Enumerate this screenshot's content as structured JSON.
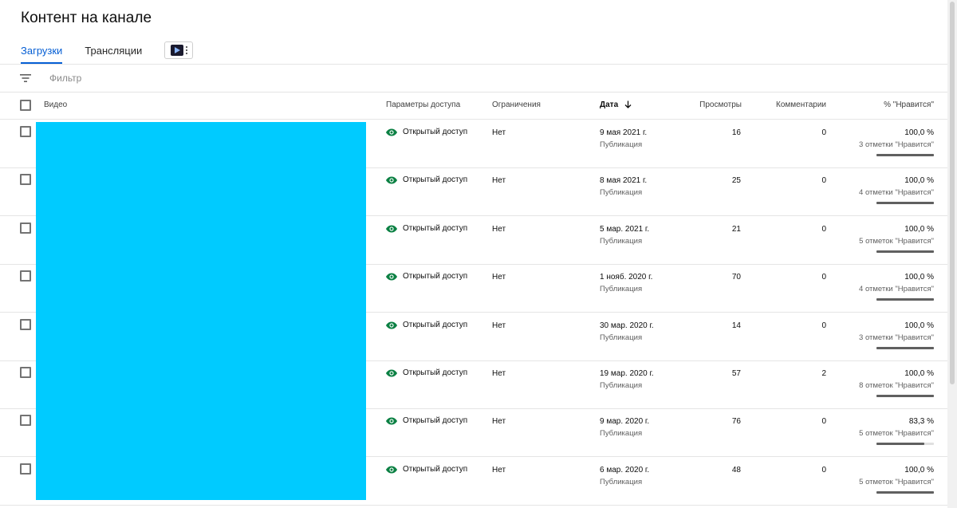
{
  "page": {
    "title": "Контент на канале"
  },
  "tabs": [
    {
      "label": "Загрузки",
      "active": true
    },
    {
      "label": "Трансляции",
      "active": false
    }
  ],
  "filter": {
    "placeholder": "Фильтр"
  },
  "columns": {
    "video": "Видео",
    "visibility": "Параметры доступа",
    "restrictions": "Ограничения",
    "date": "Дата",
    "views": "Просмотры",
    "comments": "Комментарии",
    "likes": "% \"Нравится\""
  },
  "colors": {
    "accent": "#065fd4",
    "visibility_icon": "#0b8043",
    "redacted_thumbnail": "#00cbff"
  },
  "rows": [
    {
      "visibility": "Открытый доступ",
      "restrictions": "Нет",
      "date": "9 мая 2021 г.",
      "status": "Публикация",
      "views": "16",
      "comments": "0",
      "likes_pct": "100,0 %",
      "likes_count": "3 отметки \"Нравится\"",
      "likes_ratio": 1.0
    },
    {
      "visibility": "Открытый доступ",
      "restrictions": "Нет",
      "date": "8 мая 2021 г.",
      "status": "Публикация",
      "views": "25",
      "comments": "0",
      "likes_pct": "100,0 %",
      "likes_count": "4 отметки \"Нравится\"",
      "likes_ratio": 1.0
    },
    {
      "visibility": "Открытый доступ",
      "restrictions": "Нет",
      "date": "5 мар. 2021 г.",
      "status": "Публикация",
      "views": "21",
      "comments": "0",
      "likes_pct": "100,0 %",
      "likes_count": "5 отметок \"Нравится\"",
      "likes_ratio": 1.0
    },
    {
      "visibility": "Открытый доступ",
      "restrictions": "Нет",
      "date": "1 нояб. 2020 г.",
      "status": "Публикация",
      "views": "70",
      "comments": "0",
      "likes_pct": "100,0 %",
      "likes_count": "4 отметки \"Нравится\"",
      "likes_ratio": 1.0
    },
    {
      "visibility": "Открытый доступ",
      "restrictions": "Нет",
      "date": "30 мар. 2020 г.",
      "status": "Публикация",
      "views": "14",
      "comments": "0",
      "likes_pct": "100,0 %",
      "likes_count": "3 отметки \"Нравится\"",
      "likes_ratio": 1.0
    },
    {
      "visibility": "Открытый доступ",
      "restrictions": "Нет",
      "date": "19 мар. 2020 г.",
      "status": "Публикация",
      "views": "57",
      "comments": "2",
      "likes_pct": "100,0 %",
      "likes_count": "8 отметок \"Нравится\"",
      "likes_ratio": 1.0
    },
    {
      "visibility": "Открытый доступ",
      "restrictions": "Нет",
      "date": "9 мар. 2020 г.",
      "status": "Публикация",
      "views": "76",
      "comments": "0",
      "likes_pct": "83,3 %",
      "likes_count": "5 отметок \"Нравится\"",
      "likes_ratio": 0.833
    },
    {
      "visibility": "Открытый доступ",
      "restrictions": "Нет",
      "date": "6 мар. 2020 г.",
      "status": "Публикация",
      "views": "48",
      "comments": "0",
      "likes_pct": "100,0 %",
      "likes_count": "5 отметок \"Нравится\"",
      "likes_ratio": 1.0
    }
  ]
}
